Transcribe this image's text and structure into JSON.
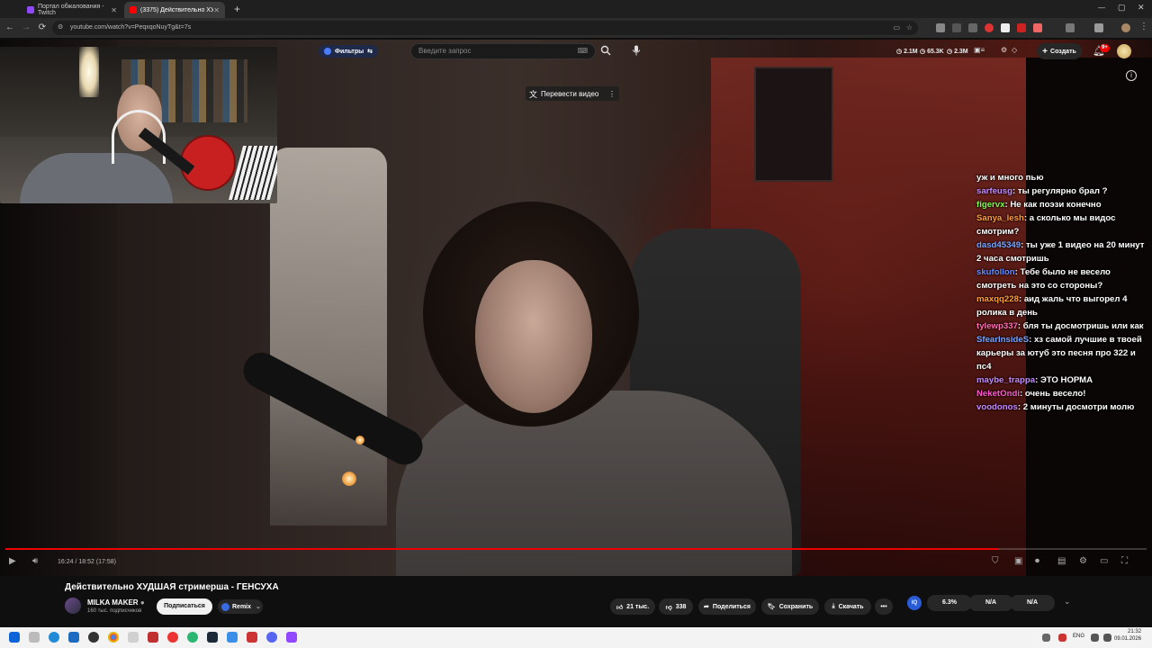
{
  "browser": {
    "tabs": [
      {
        "title": "Портал обжалования - Twitch",
        "color": "#9146ff"
      },
      {
        "title": "(3375) Действительно ХУДШАЯ",
        "color": "#ff0000"
      }
    ],
    "new_tab": "+",
    "url": "youtube.com/watch?v=PeqxqoNuyTg&t=7s",
    "nav": {
      "back": "←",
      "forward": "→",
      "reload": "⟳"
    },
    "window_controls": {
      "minimize": "—",
      "maximize": "▢",
      "close": "✕"
    }
  },
  "youtube": {
    "filters_label": "Фильтры",
    "search_placeholder": "Введите запрос",
    "stats": [
      {
        "icon": "clock-icon",
        "value": "2.1M"
      },
      {
        "icon": "views-icon",
        "value": "65.3K"
      },
      {
        "icon": "users-icon",
        "value": "2.3M"
      }
    ],
    "create_label": "Создать",
    "notifications_badge": "9+",
    "translate_label": "Перевести видео"
  },
  "player": {
    "time": "16:24 / 18:52 (17:58)",
    "progress": 0.87
  },
  "chat": [
    {
      "user": "",
      "color": "#ffffff",
      "text": "уж и много пью"
    },
    {
      "user": "sarfeusg",
      "color": "#c58bff",
      "text": "ты регулярно брал ?"
    },
    {
      "user": "figervx",
      "color": "#7cff4a",
      "text": "Не как поэзи конечно"
    },
    {
      "user": "Sanya_lesh",
      "color": "#ff9f3f",
      "text": "а сколько мы видос смотрим?"
    },
    {
      "user": "dasd45349",
      "color": "#7aa6ff",
      "text": "ты уже 1 видео на 20 минут 2 часа смотришь"
    },
    {
      "user": "skufollon",
      "color": "#6a8dff",
      "text": "Тебе было не весело смотреть на это со стороны?"
    },
    {
      "user": "maxqq228",
      "color": "#ff9f3f",
      "text": "аид жаль что выгорел 4 ролика в день"
    },
    {
      "user": "tylewp337",
      "color": "#ff6fb0",
      "text": "бля ты досмотришь или как"
    },
    {
      "user": "SfearInsideS",
      "color": "#7aa6ff",
      "text": "хз самой лучшие в твоей карьеры за ютуб это песня про 322 и пс4"
    },
    {
      "user": "maybe_trappa",
      "color": "#c58bff",
      "text": "ЭТО НОРМА"
    },
    {
      "user": "NeketOndi",
      "color": "#ff5bd0",
      "text": "очень весело!"
    },
    {
      "user": "voodonos",
      "color": "#c58bff",
      "text": "2 минуты досмотри молю"
    }
  ],
  "video_info": {
    "title": "Действительно ХУДШАЯ стримерша - ГЕНСУХА",
    "channel": "MILKA MAKER",
    "subscribers": "160 тыс. подписчиков",
    "subscribe_label": "Подписаться",
    "remix_label": "Remix",
    "likes": "21 тыс.",
    "dislikes": "338",
    "share_label": "Поделиться",
    "save_label": "Сохранить",
    "download_label": "Скачать",
    "more_label": "•••",
    "ext_stats": [
      "6.3%",
      "N/A",
      "N/A"
    ]
  },
  "taskbar": {
    "lang": "ENG",
    "time": "21:32",
    "date": "09.01.2026"
  }
}
